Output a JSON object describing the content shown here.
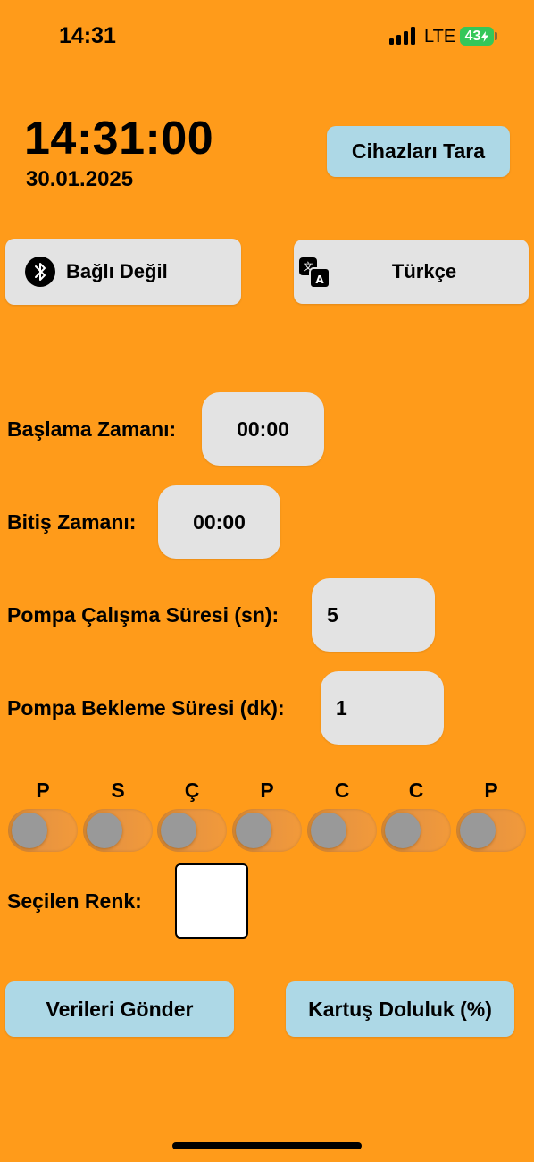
{
  "status_bar": {
    "time": "14:31",
    "network": "LTE",
    "battery": "43"
  },
  "clock": {
    "time": "14:31:00",
    "date": "30.01.2025"
  },
  "buttons": {
    "scan": "Cihazları Tara",
    "bluetooth_status": "Bağlı Değil",
    "language": "Türkçe",
    "send": "Verileri Gönder",
    "cartridge": "Kartuş Doluluk (%)"
  },
  "fields": {
    "start_label": "Başlama Zamanı:",
    "start_value": "00:00",
    "end_label": "Bitiş Zamanı:",
    "end_value": "00:00",
    "pump_run_label": "Pompa Çalışma Süresi (sn):",
    "pump_run_value": "5",
    "pump_wait_label": "Pompa Bekleme Süresi (dk):",
    "pump_wait_value": "1"
  },
  "days": [
    {
      "label": "P",
      "on": false
    },
    {
      "label": "S",
      "on": false
    },
    {
      "label": "Ç",
      "on": false
    },
    {
      "label": "P",
      "on": false
    },
    {
      "label": "C",
      "on": false
    },
    {
      "label": "C",
      "on": false
    },
    {
      "label": "P",
      "on": false
    }
  ],
  "color_picker": {
    "label": "Seçilen Renk:",
    "selected": "#FFFFFF"
  },
  "colors": {
    "background": "#FF9B1A",
    "accent_button": "#ADD8E6",
    "field": "#E3E3E3"
  }
}
